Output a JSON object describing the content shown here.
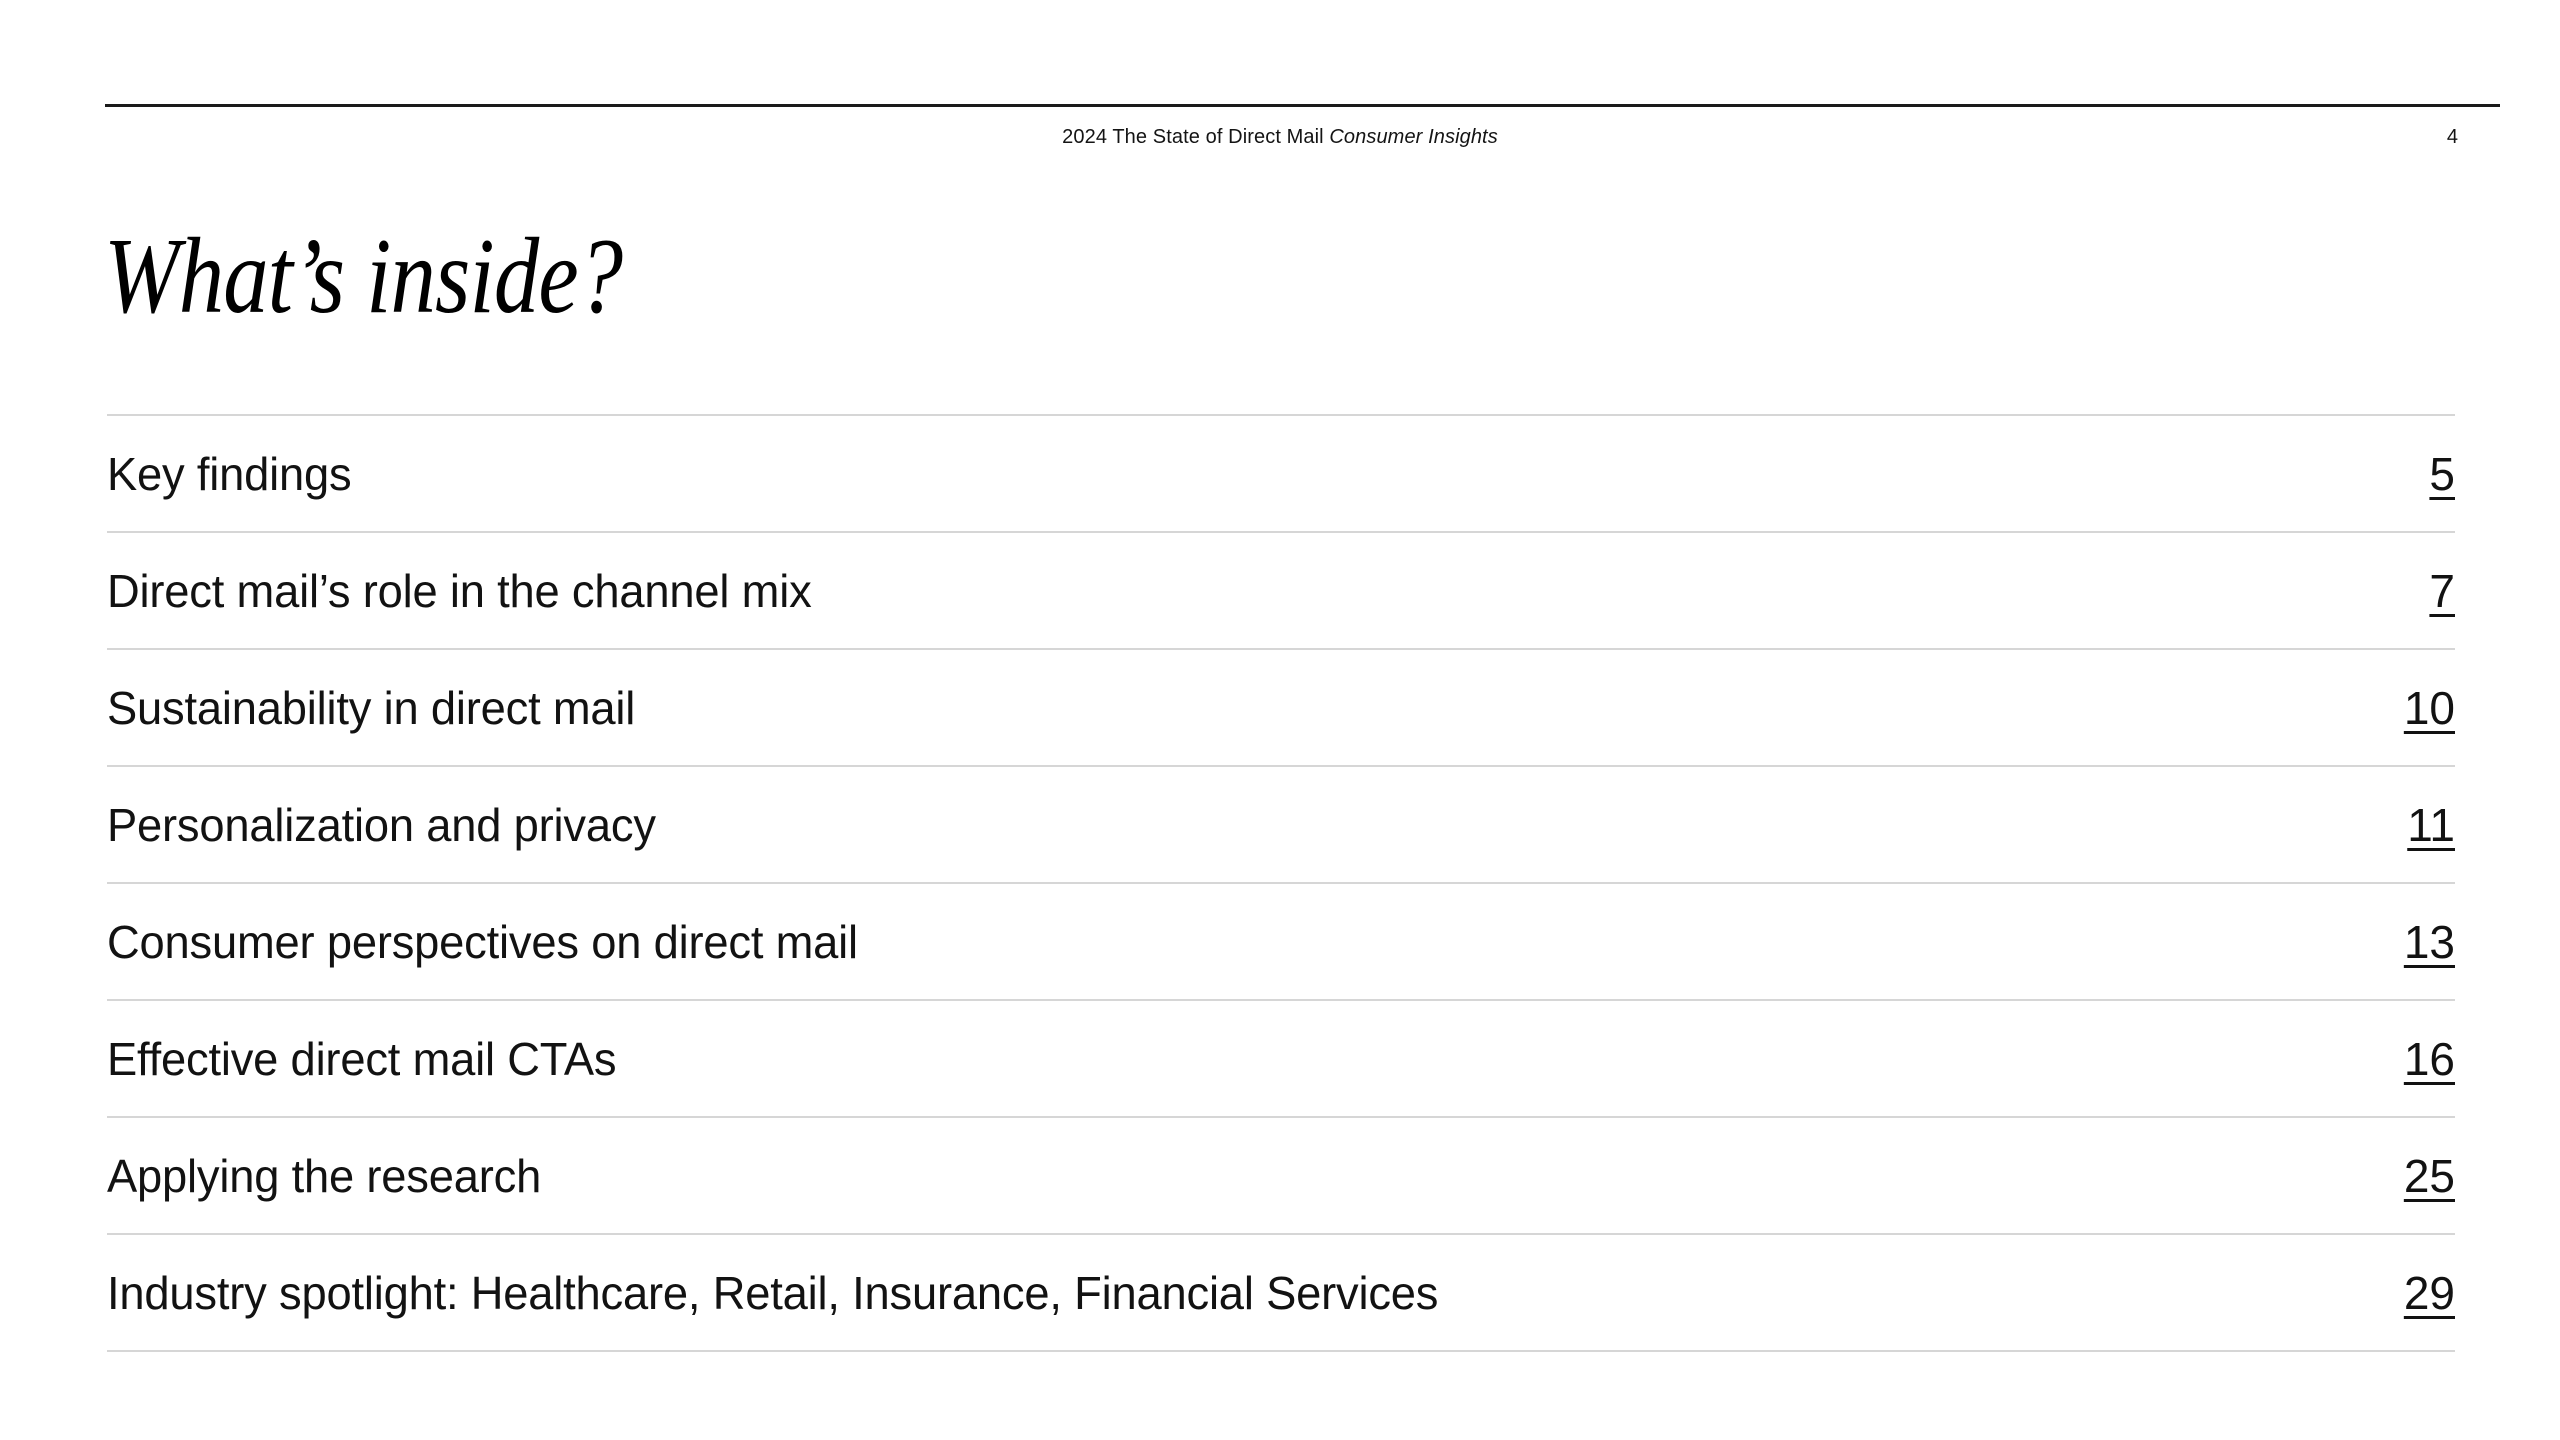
{
  "header": {
    "running_head_prefix": "2024 The State of Direct Mail ",
    "running_head_italic": "Consumer Insights",
    "folio": "4"
  },
  "title": "What’s inside?",
  "toc": {
    "entries": [
      {
        "label": "Key findings",
        "page": "5"
      },
      {
        "label": "Direct mail’s role in the channel mix",
        "page": "7"
      },
      {
        "label": "Sustainability in direct mail",
        "page": "10"
      },
      {
        "label": "Personalization and privacy",
        "page": "11"
      },
      {
        "label": "Consumer perspectives on direct mail",
        "page": "13"
      },
      {
        "label": "Effective direct mail CTAs",
        "page": "16"
      },
      {
        "label": "Applying the research",
        "page": "25"
      },
      {
        "label": "Industry spotlight: Healthcare, Retail, Insurance, Financial Services",
        "page": "29"
      }
    ]
  },
  "colors": {
    "page_background": "#ffffff",
    "text": "#121212",
    "top_rule": "#1a1a1a",
    "divider": "#d6d6d6"
  }
}
